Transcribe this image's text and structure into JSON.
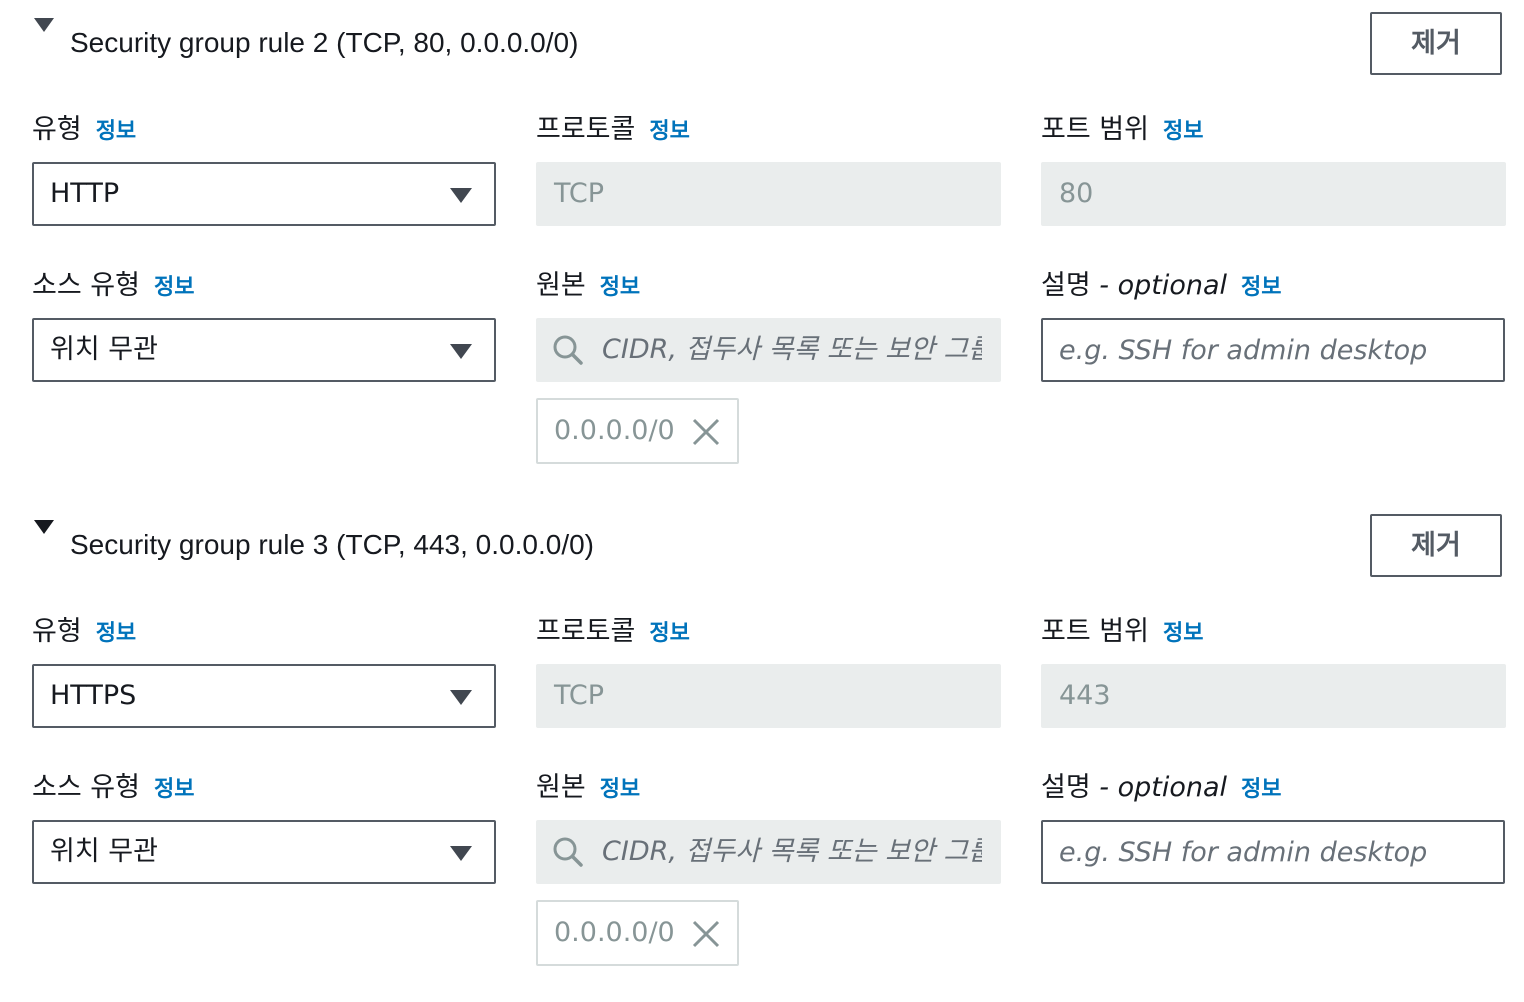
{
  "common": {
    "info": "정보",
    "remove_label": "제거",
    "labels": {
      "type": "유형",
      "protocol": "프로토콜",
      "port_range": "포트 범위",
      "source_type": "소스 유형",
      "source": "원본",
      "description": "설명",
      "description_suffix": " - optional"
    },
    "source_search_placeholder": "CIDR, 접두사 목록 또는 보안 그룹",
    "description_placeholder": "e.g. SSH for admin desktop"
  },
  "rules": [
    {
      "title": "Security group rule 2 (TCP, 80, 0.0.0.0/0)",
      "type_value": "HTTP",
      "protocol_value": "TCP",
      "port_value": "80",
      "source_type_value": "위치 무관",
      "source_token": "0.0.0.0/0",
      "expanded": true
    },
    {
      "title": "Security group rule 3 (TCP, 443, 0.0.0.0/0)",
      "type_value": "HTTPS",
      "protocol_value": "TCP",
      "port_value": "443",
      "source_type_value": "위치 무관",
      "source_token": "0.0.0.0/0",
      "expanded": true
    }
  ],
  "icons": {
    "caret": "caret-down-icon",
    "search": "search-icon",
    "dismiss": "close-icon",
    "dropdown": "chevron-down-icon"
  },
  "colors": {
    "link": "#0073bb",
    "border": "#545b64",
    "readonly_bg": "#eaeded",
    "disabled_text": "#879596"
  }
}
